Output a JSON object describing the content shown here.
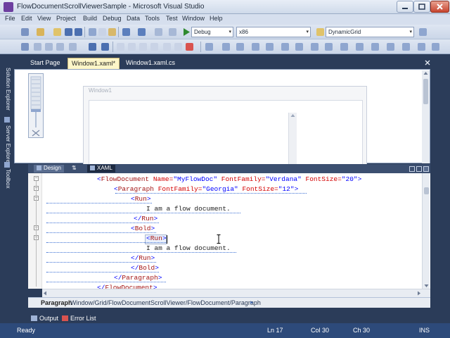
{
  "window": {
    "title": "FlowDocumentScrollViewerSample - Microsoft Visual Studio"
  },
  "menu": [
    "File",
    "Edit",
    "View",
    "Project",
    "Build",
    "Debug",
    "Data",
    "Tools",
    "Test",
    "Window",
    "Help"
  ],
  "toolbar": {
    "config": "Debug",
    "platform": "x86",
    "find": "DynamicGrid"
  },
  "side_tabs": [
    "Solution Explorer",
    "Server Explorer",
    "Toolbox"
  ],
  "doc_tabs": [
    "Start Page",
    "Window1.xaml*",
    "Window1.xaml.cs"
  ],
  "designer": {
    "window_title": "Window1"
  },
  "split_tabs": [
    "Design",
    "⇅",
    "XAML"
  ],
  "code_lines": [
    {
      "parts": [
        [
          "br",
          "<"
        ],
        [
          "kw",
          "FlowDocument"
        ],
        [
          "at",
          " Name="
        ],
        [
          "vl",
          "\"MyFlowDoc\""
        ],
        [
          "at",
          " FontFamily="
        ],
        [
          "vl",
          "\"Verdana\""
        ],
        [
          "at",
          " FontSize="
        ],
        [
          "vl",
          "\"20\""
        ],
        [
          "br",
          ">"
        ]
      ]
    },
    {
      "parts": [
        [
          "br",
          "<"
        ],
        [
          "kw",
          "Paragraph"
        ],
        [
          "at",
          " FontFamily="
        ],
        [
          "vl",
          "\"Georgia\""
        ],
        [
          "at",
          " FontSize="
        ],
        [
          "vl",
          "\"12\""
        ],
        [
          "br",
          ">"
        ]
      ]
    },
    {
      "parts": [
        [
          "br",
          "<"
        ],
        [
          "kw",
          "Run"
        ],
        [
          "br",
          ">"
        ]
      ]
    },
    {
      "parts": [
        [
          "tx",
          "I am a flow document."
        ]
      ]
    },
    {
      "parts": [
        [
          "br",
          "</"
        ],
        [
          "kw",
          "Run"
        ],
        [
          "br",
          ">"
        ]
      ]
    },
    {
      "parts": [
        [
          "br",
          "<"
        ],
        [
          "kw",
          "Bold"
        ],
        [
          "br",
          ">"
        ]
      ]
    },
    {
      "parts": [
        [
          "br",
          "<"
        ],
        [
          "kw",
          "Run"
        ],
        [
          "br",
          ">"
        ]
      ]
    },
    {
      "parts": [
        [
          "tx",
          "I am a flow document."
        ]
      ]
    },
    {
      "parts": [
        [
          "br",
          "</"
        ],
        [
          "kw",
          "Run"
        ],
        [
          "br",
          ">"
        ]
      ]
    },
    {
      "parts": [
        [
          "br",
          "</"
        ],
        [
          "kw",
          "Bold"
        ],
        [
          "br",
          ">"
        ]
      ]
    },
    {
      "parts": [
        [
          "br",
          "</"
        ],
        [
          "kw",
          "Paragraph"
        ],
        [
          "br",
          ">"
        ]
      ]
    },
    {
      "parts": [
        [
          "br",
          "</"
        ],
        [
          "kw",
          "FlowDocument"
        ],
        [
          "br",
          ">"
        ]
      ]
    }
  ],
  "breadcrumb": {
    "current": "Paragraph",
    "path": "Window/Grid/FlowDocumentScrollViewer/FlowDocument/Paragraph"
  },
  "output_tabs": [
    "Output",
    "Error List"
  ],
  "status": {
    "ready": "Ready",
    "ln": "Ln 17",
    "col": "Col 30",
    "ch": "Ch 30",
    "mode": "INS"
  },
  "colors": {
    "chrome": "#2b3c59",
    "statusbar": "#2d4a7a",
    "active_tab": "#fdf6c8",
    "xml_element": "#a31515",
    "xml_attribute": "#d40000",
    "xml_value": "#0000ff"
  }
}
